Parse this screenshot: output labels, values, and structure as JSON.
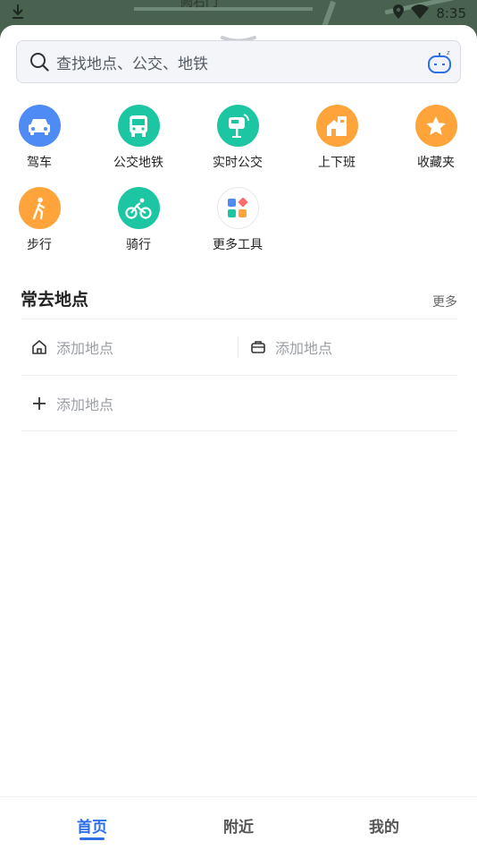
{
  "status_bar": {
    "time": "8:35",
    "map_label": "阙右门"
  },
  "search": {
    "placeholder": "查找地点、公交、地铁"
  },
  "tools": [
    {
      "label": "驾车",
      "icon": "car-icon",
      "color": "#4f8bf5"
    },
    {
      "label": "公交地铁",
      "icon": "bus-icon",
      "color": "#1cc6a3"
    },
    {
      "label": "实时公交",
      "icon": "bus-stop-icon",
      "color": "#1cc6a3"
    },
    {
      "label": "上下班",
      "icon": "home-office-icon",
      "color": "#ffa43a"
    },
    {
      "label": "收藏夹",
      "icon": "star-icon",
      "color": "#ffa43a"
    },
    {
      "label": "步行",
      "icon": "walk-icon",
      "color": "#ffa43a"
    },
    {
      "label": "骑行",
      "icon": "bike-icon",
      "color": "#1cc6a3"
    },
    {
      "label": "更多工具",
      "icon": "grid-icon",
      "color": "#ffffff"
    }
  ],
  "frequent": {
    "title": "常去地点",
    "more": "更多",
    "home_label": "添加地点",
    "work_label": "添加地点",
    "add_label": "添加地点"
  },
  "bottom_nav": [
    {
      "label": "首页",
      "active": true
    },
    {
      "label": "附近",
      "active": false
    },
    {
      "label": "我的",
      "active": false
    }
  ]
}
